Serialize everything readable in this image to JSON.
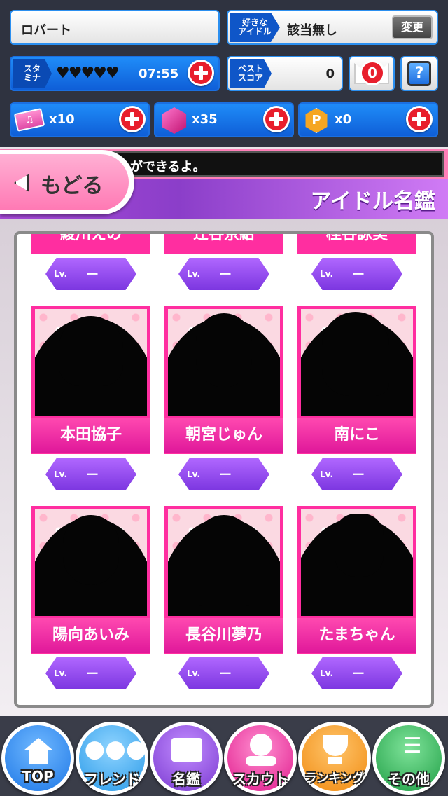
{
  "header": {
    "player_name": "ロバート",
    "fav_idol_tag": "好きな\nアイドル",
    "fav_idol_value": "該当無し",
    "change_label": "変更",
    "stamina_tag": "スタ\nミナ",
    "stamina_hearts": "♥♥♥♥♥",
    "stamina_timer": "07:55",
    "best_score_tag": "ベスト\nスコア",
    "best_score_value": "0",
    "mail_count": "0",
    "help_label": "?",
    "ticket_count": "x10",
    "gem_count": "x35",
    "point_count": "x0",
    "point_icon_label": "P"
  },
  "ticker_text": "ができるよ。",
  "back_label": "もどる",
  "page_title": "アイドル名鑑",
  "cards_top_partial": [
    "綾川えの",
    "辻谷京結",
    "桂谷詠美"
  ],
  "cards": [
    {
      "name": "本田協子"
    },
    {
      "name": "朝宮じゅん"
    },
    {
      "name": "南にこ"
    },
    {
      "name": "陽向あいみ"
    },
    {
      "name": "長谷川夢乃"
    },
    {
      "name": "たまちゃん"
    }
  ],
  "level": {
    "label": "Lv.",
    "value": "ー"
  },
  "nav": [
    {
      "label": "TOP",
      "icon": "home-icon",
      "color": "#2f8ff2"
    },
    {
      "label": "フレンド",
      "icon": "friends-icon",
      "color": "#3aaaf0"
    },
    {
      "label": "名鑑",
      "icon": "book-icon",
      "color": "#9a4ee0"
    },
    {
      "label": "スカウト",
      "icon": "scout-icon",
      "color": "#ff3aa8"
    },
    {
      "label": "ランキング",
      "icon": "trophy-icon",
      "color": "#ff9a1a"
    },
    {
      "label": "その他",
      "icon": "list-icon",
      "color": "#2fbf5a"
    }
  ]
}
